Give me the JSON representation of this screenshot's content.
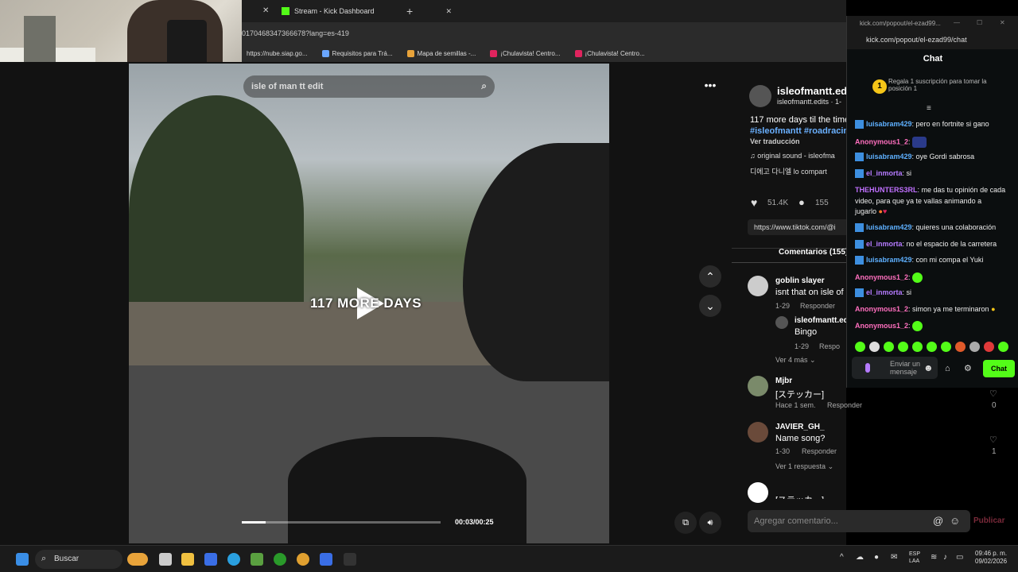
{
  "browser": {
    "tab_label": "Stream - Kick Dashboard",
    "url": "0170468347366678?lang=es-419",
    "bookmarks": [
      "https://nube.siap.go...",
      "Requisitos para Trá...",
      "Mapa de semillas -...",
      "¡Chulavista! Centro...",
      "¡Chulavista! Centro..."
    ]
  },
  "video": {
    "search_placeholder": "isle of man tt edit",
    "overlay_text": "117 MORE DAYS",
    "time": "00:03/00:25",
    "progress": 0.12
  },
  "post": {
    "username": "isleofmantt.edi",
    "handle": "isleofmantt.edits · 1-",
    "caption": "117 more days til the time",
    "hashtags": "#isleofmantt #roadracin",
    "translate": "Ver traducción",
    "sound": "original sound - isleofma",
    "sound2": "디에고 다니엘 lo compart",
    "likes": "51.4K",
    "comments_count": "155",
    "link": "https://www.tiktok.com/@i",
    "comments_tab": "Comentarios (155)"
  },
  "comments": [
    {
      "user": "goblin slayer",
      "text": "isnt that on isle of",
      "date": "1-29",
      "reply": "Responder"
    },
    {
      "user": "isleofmantt.edi",
      "text": "Bingo",
      "date": "1-29",
      "reply": "Respo"
    },
    {
      "more": "Ver 4 más"
    },
    {
      "user": "Mjbr",
      "text": "[ステッカー]",
      "date": "Hace 1 sem.",
      "reply": "Responder",
      "likes": "0"
    },
    {
      "user": "JAVIER_GH_",
      "text": "Name song?",
      "date": "1-30",
      "reply": "Responder",
      "likes": "1"
    },
    {
      "more": "Ver 1 respuesta"
    },
    {
      "text": "[ステッカー]"
    }
  ],
  "comment_input": {
    "placeholder": "Agregar comentario...",
    "post": "Publicar"
  },
  "kick": {
    "window_title": "kick.com/popout/el-ezad99...",
    "url": "kick.com/popout/el-ezad99/chat",
    "header": "Chat",
    "promo": "Regala 1 suscripción para tomar la posición 1",
    "promo_rank": "1",
    "messages": [
      {
        "user": "luisabram429",
        "text": ": pero en fortnite si gano",
        "color": "#5eb0ff"
      },
      {
        "user": "Anonymous1_2",
        "text": ":",
        "color": "#ff6fbf"
      },
      {
        "user": "luisabram429",
        "text": ": oye Gordi sabrosa",
        "color": "#5eb0ff"
      },
      {
        "user": "el_inmorta",
        "text": ": si",
        "color": "#b57bff"
      },
      {
        "user": "THEHUNTERS3RL",
        "text": ": me das tu opinión de cada",
        "color": "#c070ff"
      },
      {
        "user": "",
        "text": "video, para que ya te vallas animando a",
        "color": "#fff"
      },
      {
        "user": "",
        "text": "jugarlo",
        "color": "#fff"
      },
      {
        "user": "luisabram429",
        "text": ": quieres una colaboración",
        "color": "#5eb0ff"
      },
      {
        "user": "el_inmorta",
        "text": ": no el espacio de la carretera",
        "color": "#b57bff"
      },
      {
        "user": "luisabram429",
        "text": ": con mi compa el Yuki",
        "color": "#5eb0ff"
      },
      {
        "user": "Anonymous1_2",
        "text": ":",
        "color": "#ff6fbf"
      },
      {
        "user": "el_inmorta",
        "text": ": si",
        "color": "#b57bff"
      },
      {
        "user": "Anonymous1_2",
        "text": ": simon ya me terminaron",
        "color": "#ff6fbf"
      },
      {
        "user": "Anonymous1_2",
        "text": ":",
        "color": "#ff6fbf"
      }
    ],
    "input_placeholder": "Enviar un mensaje",
    "send": "Chat"
  },
  "taskbar": {
    "search": "Buscar",
    "lang": "ESP",
    "lang2": "LAA",
    "time": "09:46 p. m.",
    "date": "09/02/2026"
  }
}
